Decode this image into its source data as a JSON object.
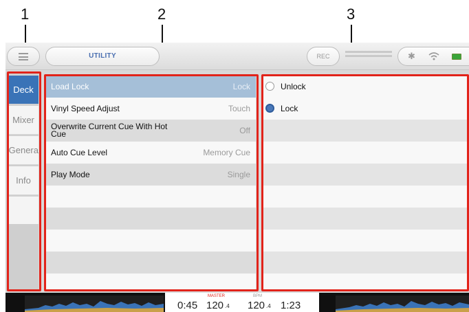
{
  "callouts": [
    "1",
    "2",
    "3"
  ],
  "header": {
    "title": "UTILITY",
    "rec_label": "REC",
    "icons": [
      "menu-icon",
      "bluetooth-icon",
      "wifi-icon",
      "battery-icon"
    ]
  },
  "tabs": [
    {
      "label": "Deck",
      "active": true
    },
    {
      "label": "Mixer",
      "active": false
    },
    {
      "label": "Genera",
      "active": false
    },
    {
      "label": "Info",
      "active": false
    }
  ],
  "settings": [
    {
      "label": "Load Lock",
      "value": "Lock",
      "selected": true
    },
    {
      "label": "Vinyl Speed Adjust",
      "value": "Touch"
    },
    {
      "label": "Overwrite Current Cue With Hot Cue",
      "value": "Off"
    },
    {
      "label": "Auto Cue Level",
      "value": "Memory Cue"
    },
    {
      "label": "Play Mode",
      "value": "Single"
    }
  ],
  "options": [
    {
      "label": "Unlock",
      "checked": false
    },
    {
      "label": "Lock",
      "checked": true
    }
  ],
  "footer": {
    "time_left": "0:45",
    "master_label": "MASTER",
    "master_bpm": "120",
    "master_bpm_decimal": ".4",
    "bpm_label": "BPM",
    "bpm": "120",
    "bpm_decimal": ".4",
    "time_right": "1:23"
  },
  "colors": {
    "accent": "#3a73b7",
    "selected_row": "#a5bfd8",
    "callout_frame": "#e2231a",
    "master_label": "#e2231a"
  }
}
